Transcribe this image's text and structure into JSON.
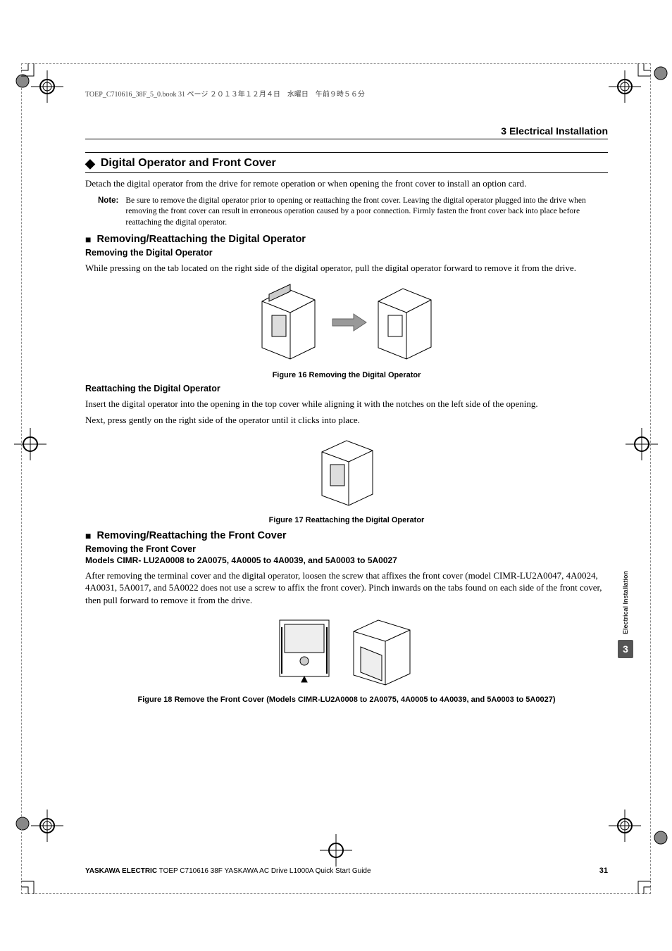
{
  "book_line": "TOEP_C710616_38F_5_0.book  31 ページ  ２０１３年１２月４日　水曜日　午前９時５６分",
  "section_header": "3  Electrical Installation",
  "h2": "Digital Operator and Front Cover",
  "intro_para": "Detach the digital operator from the drive for remote operation or when opening the front cover to install an option card.",
  "note_label": "Note:",
  "note_body": "Be sure to remove the digital operator prior to opening or reattaching the front cover. Leaving the digital operator plugged into the drive when removing the front cover can result in erroneous operation caused by a poor connection. Firmly fasten the front cover back into place before reattaching the digital operator.",
  "h3a": "Removing/Reattaching the Digital Operator",
  "h4a": "Removing the Digital Operator",
  "para_a": "While pressing on the tab located on the right side of the digital operator, pull the digital operator forward to remove it from the drive.",
  "fig16": "Figure 16  Removing the Digital Operator",
  "h4b": "Reattaching the Digital Operator",
  "para_b1": "Insert the digital operator into the opening in the top cover while aligning it with the notches on the left side of the opening.",
  "para_b2": "Next, press gently on the right side of the operator until it clicks into place.",
  "fig17": "Figure 17  Reattaching the Digital Operator",
  "h3b": "Removing/Reattaching the Front Cover",
  "h4c": "Removing the Front Cover",
  "h5c": "Models CIMR- LU2A0008 to 2A0075, 4A0005 to 4A0039, and 5A0003 to 5A0027",
  "para_c": "After removing the terminal cover and the digital operator, loosen the screw that affixes the front cover (model CIMR-LU2A0047, 4A0024, 4A0031, 5A0017, and 5A0022 does not use a screw to affix the front cover). Pinch inwards on the tabs found on each side of the front cover, then pull forward to remove it from the drive.",
  "fig18": "Figure 18  Remove the Front Cover (Models CIMR-LU2A0008 to 2A0075, 4A0005 to 4A0039, and 5A0003 to 5A0027)",
  "side_tab_label": "Electrical Installation",
  "side_tab_num": "3",
  "footer_bold": "YASKAWA ELECTRIC",
  "footer_rest": " TOEP C710616 38F YASKAWA AC Drive L1000A Quick Start Guide",
  "page_num": "31"
}
